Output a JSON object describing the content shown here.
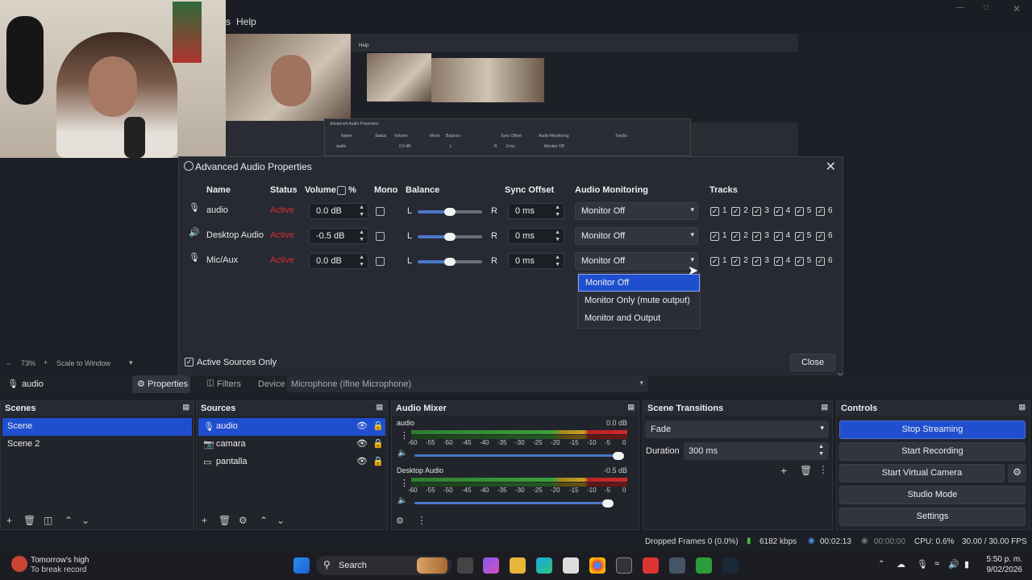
{
  "top_menu": {
    "help": "Help",
    "partial": "s"
  },
  "preview": {
    "help": "Help",
    "dialog_title": "Advanced Audio Properties",
    "headers": [
      "Name",
      "Status",
      "Volume",
      "Mono",
      "Balance",
      "Sync Offset",
      "Audio Monitoring",
      "Tracks"
    ],
    "row": {
      "name": "audio",
      "volume": "0.0 dB",
      "balance_l": "L",
      "balance_r": "R",
      "sync": "0 ms",
      "monitoring": "Monitor Off"
    }
  },
  "dialog": {
    "title": "Advanced Audio Properties",
    "headers": {
      "name": "Name",
      "status": "Status",
      "volume": "Volume",
      "percent": "%",
      "mono": "Mono",
      "balance": "Balance",
      "sync": "Sync Offset",
      "monitoring": "Audio Monitoring",
      "tracks": "Tracks"
    },
    "rows": [
      {
        "name": "audio",
        "status": "Active",
        "volume": "0.0 dB",
        "mono": false,
        "balance_l": "L",
        "balance_r": "R",
        "balance_value": 0.5,
        "sync": "0 ms",
        "monitoring": "Monitor Off",
        "tracks": [
          "1",
          "2",
          "3",
          "4",
          "5",
          "6"
        ]
      },
      {
        "name": "Desktop Audio",
        "status": "Active",
        "volume": "-0.5 dB",
        "mono": false,
        "balance_l": "L",
        "balance_r": "R",
        "balance_value": 0.5,
        "sync": "0 ms",
        "monitoring": "Monitor Off",
        "tracks": [
          "1",
          "2",
          "3",
          "4",
          "5",
          "6"
        ]
      },
      {
        "name": "Mic/Aux",
        "status": "Active",
        "volume": "0.0 dB",
        "mono": false,
        "balance_l": "L",
        "balance_r": "R",
        "balance_value": 0.5,
        "sync": "0 ms",
        "monitoring": "Monitor Off",
        "tracks": [
          "1",
          "2",
          "3",
          "4",
          "5",
          "6"
        ]
      }
    ],
    "dropdown_options": [
      "Monitor Off",
      "Monitor Only (mute output)",
      "Monitor and Output"
    ],
    "dropdown_selected": "Monitor Off",
    "active_sources_only": "Active Sources Only",
    "close_label": "Close"
  },
  "zoom_strip": {
    "zoom": "73%",
    "scale": "Scale to Window"
  },
  "source_bar": {
    "source": "audio",
    "properties": "Properties",
    "filters": "Filters",
    "device_label": "Device",
    "device_value": "Microphone (Ifine Microphone)"
  },
  "scenes": {
    "title": "Scenes",
    "items": [
      "Scene",
      "Scene 2"
    ],
    "selected": "Scene"
  },
  "sources": {
    "title": "Sources",
    "items": [
      {
        "name": "audio",
        "icon": "mic-icon"
      },
      {
        "name": "camara",
        "icon": "camera-icon"
      },
      {
        "name": "pantalla",
        "icon": "monitor-icon"
      }
    ],
    "selected": "audio"
  },
  "mixer": {
    "title": "Audio Mixer",
    "channels": [
      {
        "name": "audio",
        "db": "0.0 dB",
        "fader": 1.0
      },
      {
        "name": "Desktop Audio",
        "db": "-0.5 dB",
        "fader": 0.95
      }
    ],
    "scale": [
      "-60",
      "-55",
      "-50",
      "-45",
      "-40",
      "-35",
      "-30",
      "-25",
      "-20",
      "-15",
      "-10",
      "-5",
      "0"
    ]
  },
  "transitions": {
    "title": "Scene Transitions",
    "transition": "Fade",
    "duration_label": "Duration",
    "duration_value": "300 ms"
  },
  "controls": {
    "title": "Controls",
    "buttons": [
      "Stop Streaming",
      "Start Recording",
      "Start Virtual Camera",
      "Studio Mode",
      "Settings"
    ],
    "highlighted": "Stop Streaming"
  },
  "status_bar": {
    "dropped": "Dropped Frames 0 (0.0%)",
    "kbps": "6182 kbps",
    "stream_time": "00:02:13",
    "rec_time": "00:00:00",
    "cpu": "CPU: 0.6%",
    "fps": "30.00 / 30.00 FPS"
  },
  "taskbar": {
    "weather_title": "Tomorrow's high",
    "weather_sub": "To break record",
    "search": "Search",
    "time": "5:50 p. m.",
    "date": "9/02/2026"
  },
  "colors": {
    "accent": "#1f4fcf",
    "active": "#d23030",
    "bg": "#1d1f26"
  }
}
